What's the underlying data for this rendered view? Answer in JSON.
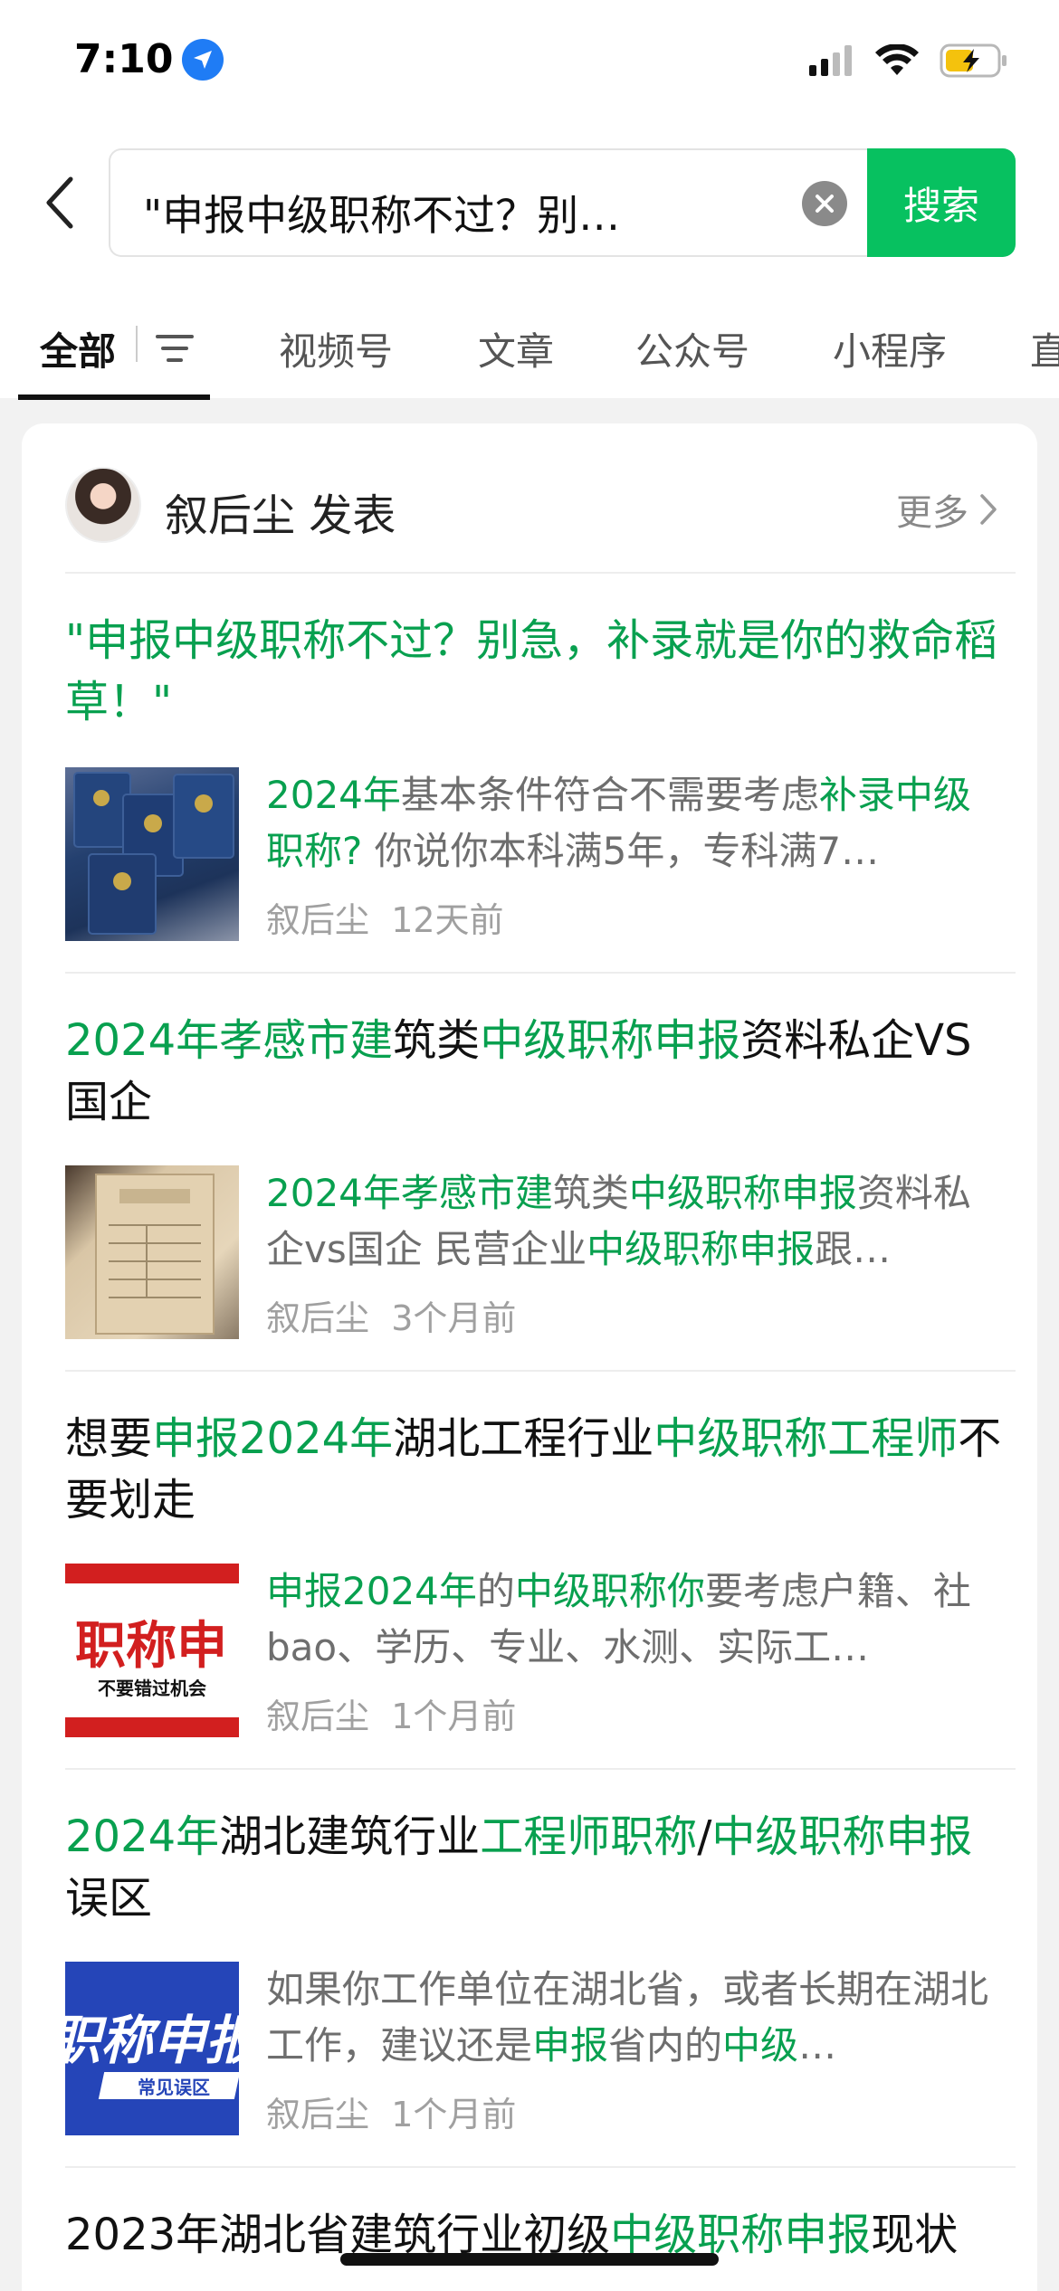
{
  "status_bar": {
    "time": "7:10"
  },
  "search": {
    "query": "\"申报中级职称不过？别…",
    "button_label": "搜索"
  },
  "tabs": [
    {
      "label": "全部",
      "active": true
    },
    {
      "label": "视频号"
    },
    {
      "label": "文章"
    },
    {
      "label": "公众号"
    },
    {
      "label": "小程序"
    },
    {
      "label": "直"
    }
  ],
  "author": {
    "name": "叙后尘 发表",
    "more_label": "更多"
  },
  "results": [
    {
      "title_parts": [
        {
          "t": "\"申报中级职称不过？别急，补录就是你的救命稻草！\"",
          "hl": true
        }
      ],
      "snippet_parts": [
        {
          "t": "2024年",
          "hl": true
        },
        {
          "t": "基本条件符合不需要考虑",
          "hl": false
        },
        {
          "t": "补录中级职称?",
          "hl": true
        },
        {
          "t": " 你说你本科满5年，专科满7…",
          "hl": false
        }
      ],
      "source": "叙后尘",
      "time": "12天前"
    },
    {
      "title_parts": [
        {
          "t": "2024年孝感市建",
          "hl": true
        },
        {
          "t": "筑类",
          "hl": false
        },
        {
          "t": "中级职称申报",
          "hl": true
        },
        {
          "t": "资料私企VS国企",
          "hl": false
        }
      ],
      "snippet_parts": [
        {
          "t": "2024年孝感市建",
          "hl": true
        },
        {
          "t": "筑类",
          "hl": false
        },
        {
          "t": "中级职称申报",
          "hl": true
        },
        {
          "t": "资料私企vs国企 民营企业",
          "hl": false
        },
        {
          "t": "中级职称申报",
          "hl": true
        },
        {
          "t": "跟…",
          "hl": false
        }
      ],
      "source": "叙后尘",
      "time": "3个月前"
    },
    {
      "title_parts": [
        {
          "t": "想要",
          "hl": false
        },
        {
          "t": "申报2024年",
          "hl": true
        },
        {
          "t": "湖北工程行业",
          "hl": false
        },
        {
          "t": "中级职称工程师",
          "hl": true
        },
        {
          "t": "不要划走",
          "hl": false
        }
      ],
      "snippet_parts": [
        {
          "t": "申报2024年",
          "hl": true
        },
        {
          "t": "的",
          "hl": false
        },
        {
          "t": "中级职称你",
          "hl": true
        },
        {
          "t": "要考虑户籍、社bao、学历、专业、水测、实际工…",
          "hl": false
        }
      ],
      "thumb_text": {
        "main": "职称申",
        "sub": "不要错过机会"
      },
      "source": "叙后尘",
      "time": "1个月前"
    },
    {
      "title_parts": [
        {
          "t": "2024年",
          "hl": true
        },
        {
          "t": "湖北建筑行业",
          "hl": false
        },
        {
          "t": "工程师职称",
          "hl": true
        },
        {
          "t": "/",
          "hl": false
        },
        {
          "t": "中级职称申报",
          "hl": true
        },
        {
          "t": "误区",
          "hl": false
        }
      ],
      "snippet_parts": [
        {
          "t": "如果你工作单位在湖北省，或者长期在湖北工作，建议还是",
          "hl": false
        },
        {
          "t": "申报",
          "hl": true
        },
        {
          "t": "省内的",
          "hl": false
        },
        {
          "t": "中级",
          "hl": true
        },
        {
          "t": "…",
          "hl": false
        }
      ],
      "thumb_text": {
        "main": "职称申报",
        "sub": "常见误区"
      },
      "source": "叙后尘",
      "time": "1个月前"
    },
    {
      "title_parts": [
        {
          "t": "2023年湖北省建筑行业初级",
          "hl": false
        },
        {
          "t": "中级职称申报",
          "hl": true
        },
        {
          "t": "现状",
          "hl": false
        }
      ]
    }
  ],
  "colors": {
    "accent": "#07c160",
    "highlight": "#08a04f"
  }
}
